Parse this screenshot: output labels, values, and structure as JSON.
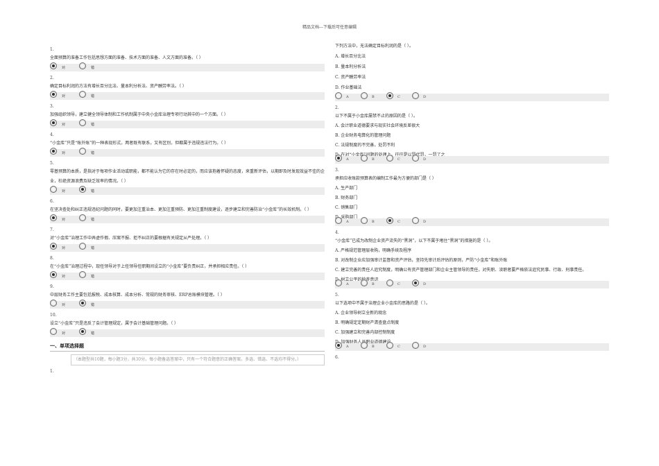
{
  "header": "精品文档---下载后可任意编辑",
  "tf_questions": [
    {
      "num": "1.",
      "text": "全面预算的准备工作包括思想方面的准备、技术方面的准备、人文方面的准备。（ ）",
      "answer": "对"
    },
    {
      "num": "2.",
      "text": "确定目标利润的方法有增长百分比法、量本利分析法、资产酬劳率法。（ ）",
      "answer": "对"
    },
    {
      "num": "3.",
      "text": "加强组织领导，建立健全领导体制和工作机制属于中央小金库治理专项行动其中的一个方面。（ ）",
      "answer": "对"
    },
    {
      "num": "4.",
      "text": "“小金库”只是“账外账”的一种表现形式，两者既有联系，又有区别，但都属于违规违法行为。（ ）",
      "answer": "对"
    },
    {
      "num": "5.",
      "text": "零基预算的本质，是指对于每项作业活动或职能，都不能认为它的存在时必定的，而应该抱着怀疑的态度，来重新评估，以期即及时发现效益不佳的企业，杜绝资源浪费及缺乏效率的情况。（ ）",
      "answer": "错"
    },
    {
      "num": "6.",
      "text": "在坚决查处和纠正违规违纪问题的同时，要更加注重治本、更加注重预防、更加注重制度建设，逐步建立和完善防治“小金库”的长效机制。（ ）",
      "answer": "对"
    },
    {
      "num": "7.",
      "text": "对“小金库”治理工作中弄虚作假、压案不报、拒不纠正的要根据有关规定从严处理。（ ）",
      "answer": "对"
    },
    {
      "num": "8.",
      "text": "在“小金库”治理过程中，现任领导对于上任领导任职期间设立的“小金库”要负责纠正，并承担相应责任。（ ）",
      "answer": "对"
    },
    {
      "num": "9.",
      "text": "中层财务工作主要包括报税、成本核算、成本分析、常规的财务审核、ERP总账模块管理。（ ）",
      "answer": "错"
    },
    {
      "num": "10.",
      "text": "设立“小金库”只是违反了会计管理规定，属于会计基础管理问题。（ ）",
      "answer": "错"
    }
  ],
  "labels": {
    "true": "对",
    "false": "错",
    "A": "A",
    "B": "B",
    "C": "C",
    "D": "D"
  },
  "section_title": "一、单项选择题",
  "section_note": "（本题型共10题，每小题3分，共30分。每小题备选答案中，只有一个符合题意的正确答案。多选、错选、不选均不得分。）",
  "left_tail_num": "1.",
  "mc_first": {
    "text": "下列方法中，无法确定目标利润的是（ ）。",
    "options": [
      "A. 增长百分比法",
      "B. 量本利分析法",
      "C. 资产酬劳率法",
      "D. 作业基础法"
    ],
    "answer": "C"
  },
  "mc_questions": [
    {
      "num": "2.",
      "text": "以下不属于小金库屡禁不止的原因的是（ ）。",
      "options": [
        "A. 会计职业道德要求与现实社会环境反差很大",
        "B. 企业财务电算化的管理问题",
        "C. 法规制度的不完善，处罚不利"
      ],
      "last_option": "D. 在对“小金库”问题的处理上，往往是以罚代罚，一罚了之",
      "answer": "A"
    },
    {
      "num": "3.",
      "text": "承担应收账款预算表的编制工作最为方便的部门是（ ）",
      "options": [
        "A. 生产部门",
        "B. 财务部门",
        "C. 销售部门"
      ],
      "last_option": "D. 采购部门",
      "answer": "C"
    },
    {
      "num": "4.",
      "text": "“小金库”已成为改制企业资产流失的“黑洞”，以下不属于堵住“黑洞”的措施的是（ ）。",
      "options": [
        "A. 严格规范管理层收购，明确手续及程序",
        "B. 对改制企业应加强审计监督和资产评估，坚持先审计后评估的原则，严防“小金库”和账外账",
        "C. 建立完善的责任人追究制度，明确公有资产管理部门和企业主管领导的责任，对失职、渎职者要严格依法追究民事、行政、刑事责任。"
      ],
      "last_option": "D. 树立公平的检查意识",
      "answer": "D"
    },
    {
      "num": "5.",
      "text": "以下选项中不属于治理企业小金库的思路的是（ ）。",
      "options": [
        "A. 企业领导树立全新的观念",
        "B. 明确规定定期财产清查盘点制度",
        "C. 加强建立和完善内部控制制度"
      ],
      "last_option": "D. 加强财务人员职业道德建设",
      "answer": "A"
    }
  ],
  "right_tail_num": "6."
}
